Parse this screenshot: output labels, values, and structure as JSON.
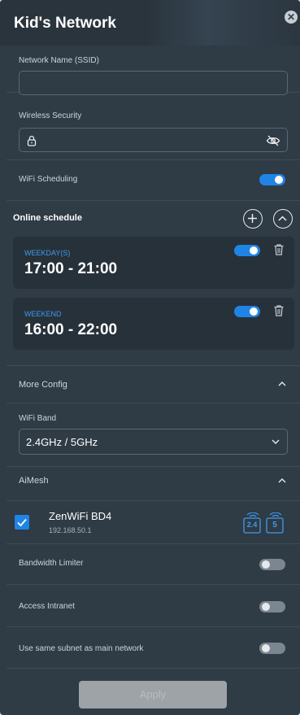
{
  "header": {
    "title": "Kid's Network",
    "close_glyph": "✕"
  },
  "ssid": {
    "label": "Network Name (SSID)",
    "value": ""
  },
  "security": {
    "label": "Wireless Security",
    "value": ""
  },
  "wifi_scheduling": {
    "label": "WiFi Scheduling",
    "enabled": true
  },
  "online_schedule": {
    "title": "Online schedule",
    "items": [
      {
        "days": "WEEKDAY(S)",
        "time": "17:00 - 21:00",
        "enabled": true
      },
      {
        "days": "WEEKEND",
        "time": "16:00 - 22:00",
        "enabled": true
      }
    ]
  },
  "more_config": {
    "label": "More Config",
    "expanded": true
  },
  "wifi_band": {
    "label": "WiFi Band",
    "value": "2.4GHz / 5GHz"
  },
  "aimesh": {
    "label": "AiMesh",
    "expanded": true,
    "node": {
      "name": "ZenWiFi BD4",
      "ip": "192.168.50.1",
      "checked": true,
      "bands": [
        "2.4",
        "5"
      ]
    }
  },
  "bandwidth_limiter": {
    "label": "Bandwidth Limiter",
    "enabled": false
  },
  "access_intranet": {
    "label": "Access Intranet",
    "enabled": false
  },
  "same_subnet": {
    "label": "Use same subnet as main network",
    "enabled": false
  },
  "apply": {
    "label": "Apply"
  },
  "colors": {
    "accent": "#1f84e6",
    "panel": "#2f3b45",
    "card": "#27313a"
  }
}
